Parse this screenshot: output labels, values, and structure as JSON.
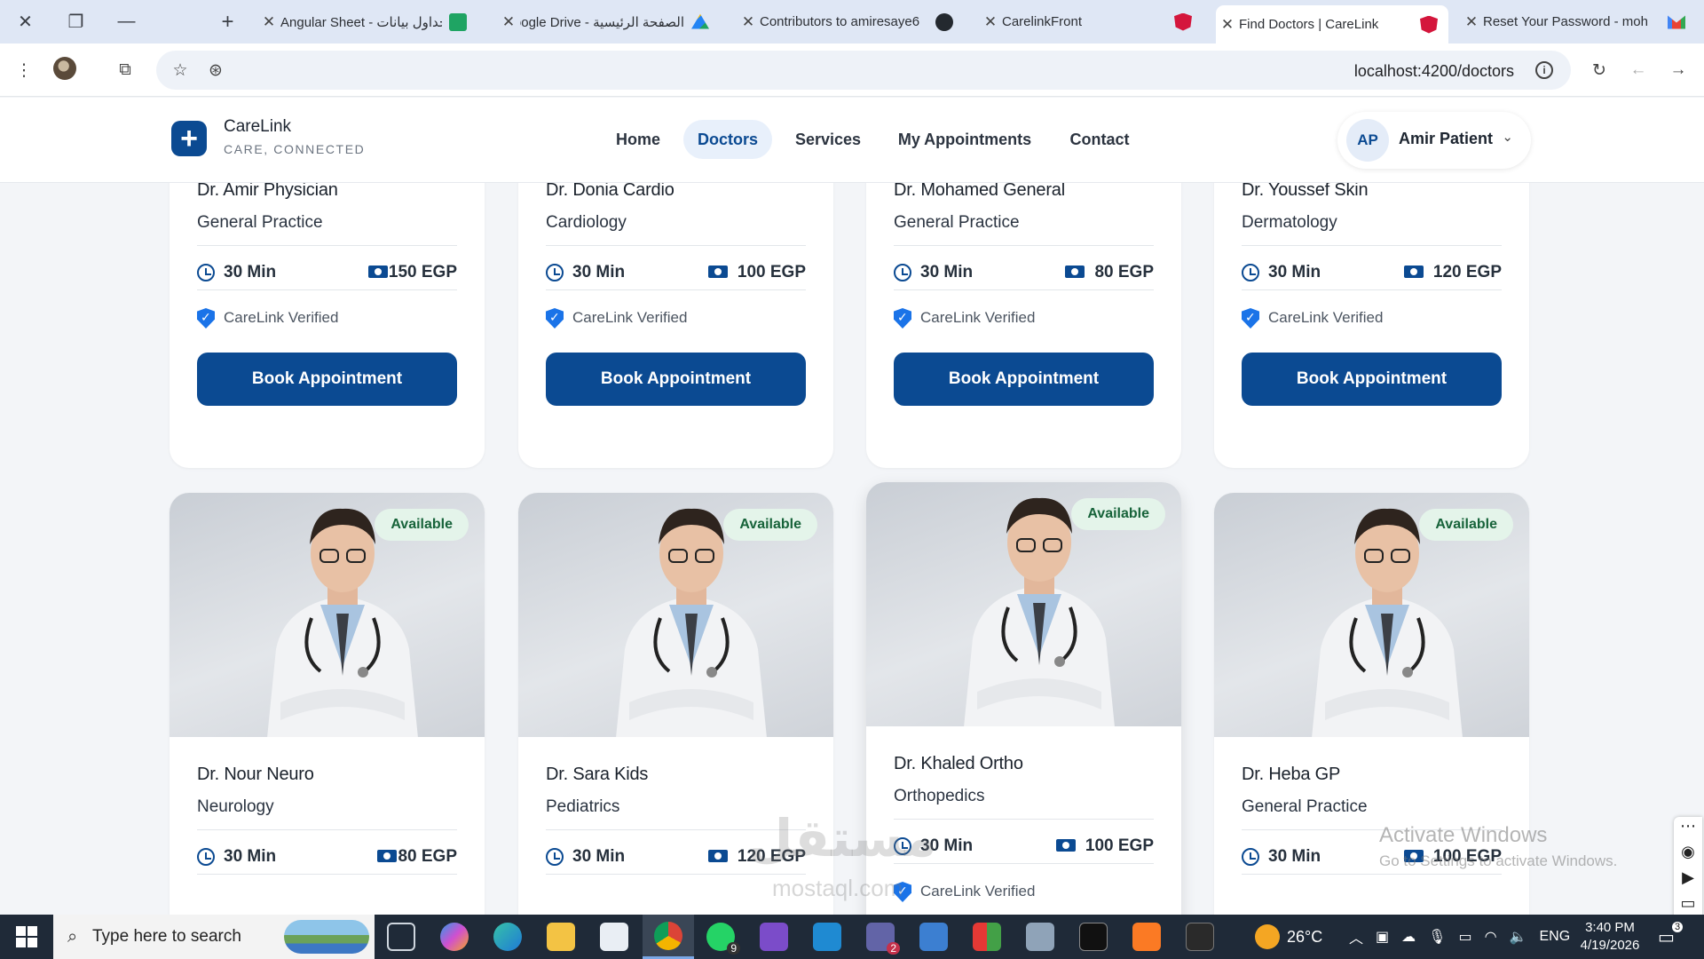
{
  "browser": {
    "tabs": [
      {
        "title": "Angular Sheet - جداول بيانات",
        "favicon": "sheets-icon"
      },
      {
        "title": "الصفحة الرئيسية - Google Drive",
        "favicon": "drive-icon"
      },
      {
        "title": "Contributors to amiresaye6",
        "favicon": "github-icon"
      },
      {
        "title": "CarelinkFront",
        "favicon": "angular-icon"
      },
      {
        "title": "Find Doctors | CareLink",
        "favicon": "angular-icon",
        "active": true
      },
      {
        "title": "Reset Your Password - moh",
        "favicon": "gmail-icon"
      }
    ],
    "url": "localhost:4200/doctors"
  },
  "app": {
    "brand": "CareLink",
    "tagline": "CARE, CONNECTED",
    "nav": [
      "Home",
      "Doctors",
      "Services",
      "My Appointments",
      "Contact"
    ],
    "active_nav": "Doctors",
    "user": {
      "initials": "AP",
      "name": "Amir Patient"
    }
  },
  "labels": {
    "available": "Available",
    "verified": "CareLink Verified",
    "book": "Book Appointment"
  },
  "doctors_top": [
    {
      "name": "Dr. Amir Physician",
      "specialty": "General Practice",
      "duration": "30 Min",
      "fee": "150 EGP"
    },
    {
      "name": "Dr. Donia Cardio",
      "specialty": "Cardiology",
      "duration": "30 Min",
      "fee": "100 EGP"
    },
    {
      "name": "Dr. Mohamed General",
      "specialty": "General Practice",
      "duration": "30 Min",
      "fee": "80 EGP"
    },
    {
      "name": "Dr. Youssef Skin",
      "specialty": "Dermatology",
      "duration": "30 Min",
      "fee": "120 EGP"
    }
  ],
  "doctors_bottom": [
    {
      "name": "Dr. Nour Neuro",
      "specialty": "Neurology",
      "duration": "30 Min",
      "fee": "80 EGP"
    },
    {
      "name": "Dr. Sara Kids",
      "specialty": "Pediatrics",
      "duration": "30 Min",
      "fee": "120 EGP"
    },
    {
      "name": "Dr. Khaled Ortho",
      "specialty": "Orthopedics",
      "duration": "30 Min",
      "fee": "100 EGP"
    },
    {
      "name": "Dr. Heba GP",
      "specialty": "General Practice",
      "duration": "30 Min",
      "fee": "100 EGP"
    }
  ],
  "overlay": {
    "activate_title": "Activate Windows",
    "activate_sub": "Go to Settings to activate Windows.",
    "watermark_ar": "مستقل",
    "watermark_en": "mostaql.com"
  },
  "taskbar": {
    "search_placeholder": "Type here to search",
    "weather": "26°C",
    "lang": "ENG",
    "time": "3:40 PM",
    "date": "4/19/2026",
    "whatsapp_badge": "9",
    "teams_badge": "2",
    "notif_badge": "3"
  },
  "colors": {
    "primary": "#0b4a92",
    "available_bg": "#e4f4ea",
    "available_text": "#17633a",
    "verified": "#1a73e8"
  }
}
